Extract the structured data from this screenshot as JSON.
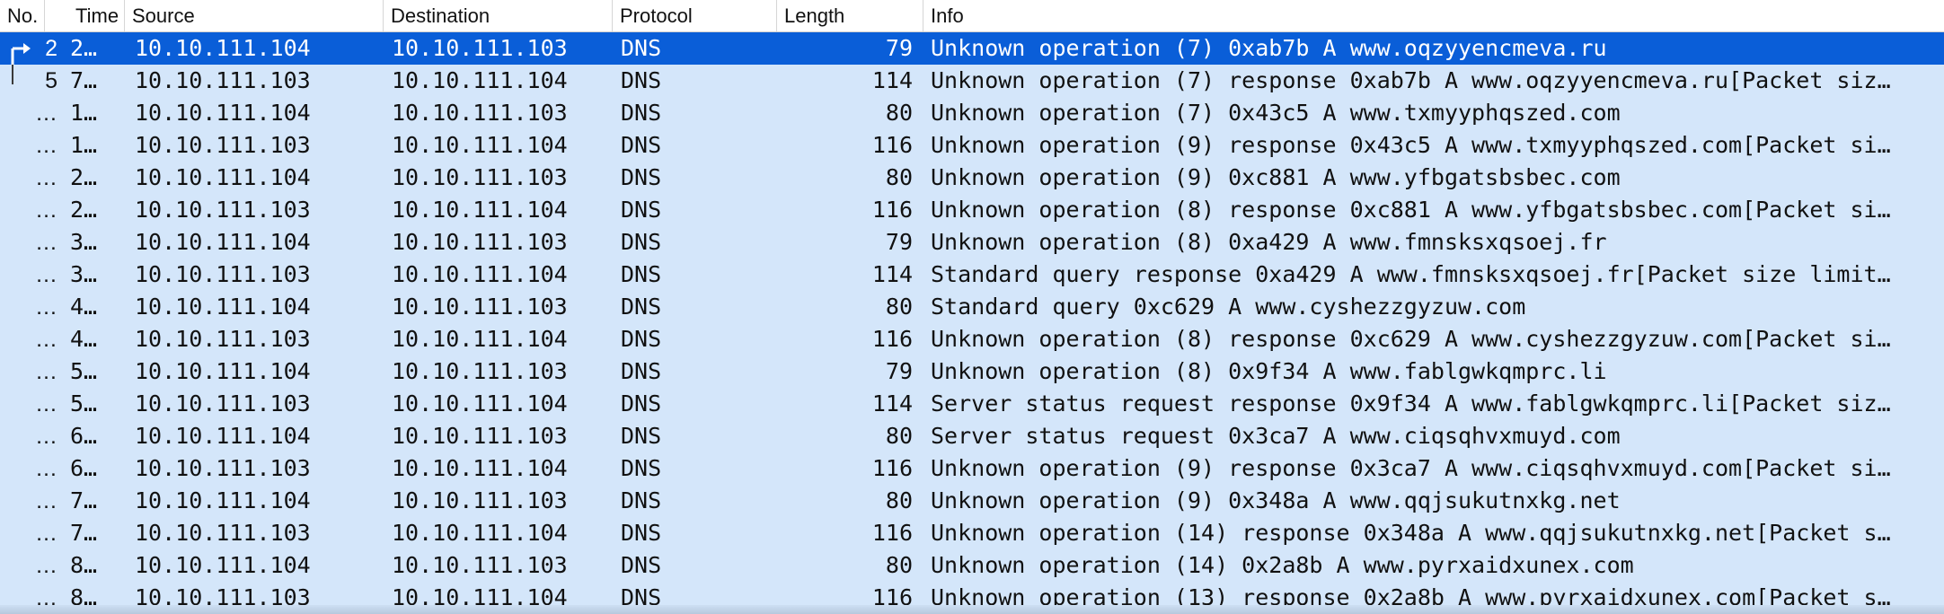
{
  "columns": {
    "no": "No.",
    "time": "Time",
    "source": "Source",
    "destination": "Destination",
    "protocol": "Protocol",
    "length": "Length",
    "info": "Info"
  },
  "colors": {
    "row_bg": "#d4e6fa",
    "selected_bg": "#0a5ed8",
    "selected_text": "#ffffff",
    "text": "#111111"
  },
  "selected_row_index": 0,
  "rows": [
    {
      "no": "2",
      "time": "2…",
      "source": "10.10.111.104",
      "destination": "10.10.111.103",
      "protocol": "DNS",
      "length": "79",
      "info": "Unknown operation (7) 0xab7b A www.oqzyyencmeva.ru"
    },
    {
      "no": "5",
      "time": "7…",
      "source": "10.10.111.103",
      "destination": "10.10.111.104",
      "protocol": "DNS",
      "length": "114",
      "info": "Unknown operation (7) response 0xab7b A www.oqzyyencmeva.ru[Packet siz…"
    },
    {
      "no": "…",
      "time": "1…",
      "source": "10.10.111.104",
      "destination": "10.10.111.103",
      "protocol": "DNS",
      "length": "80",
      "info": "Unknown operation (7) 0x43c5 A www.txmyyphqszed.com"
    },
    {
      "no": "…",
      "time": "1…",
      "source": "10.10.111.103",
      "destination": "10.10.111.104",
      "protocol": "DNS",
      "length": "116",
      "info": "Unknown operation (9) response 0x43c5 A www.txmyyphqszed.com[Packet si…"
    },
    {
      "no": "…",
      "time": "2…",
      "source": "10.10.111.104",
      "destination": "10.10.111.103",
      "protocol": "DNS",
      "length": "80",
      "info": "Unknown operation (9) 0xc881 A www.yfbgatsbsbec.com"
    },
    {
      "no": "…",
      "time": "2…",
      "source": "10.10.111.103",
      "destination": "10.10.111.104",
      "protocol": "DNS",
      "length": "116",
      "info": "Unknown operation (8) response 0xc881 A www.yfbgatsbsbec.com[Packet si…"
    },
    {
      "no": "…",
      "time": "3…",
      "source": "10.10.111.104",
      "destination": "10.10.111.103",
      "protocol": "DNS",
      "length": "79",
      "info": "Unknown operation (8) 0xa429 A www.fmnsksxqsoej.fr"
    },
    {
      "no": "…",
      "time": "3…",
      "source": "10.10.111.103",
      "destination": "10.10.111.104",
      "protocol": "DNS",
      "length": "114",
      "info": "Standard query response 0xa429 A www.fmnsksxqsoej.fr[Packet size limit…"
    },
    {
      "no": "…",
      "time": "4…",
      "source": "10.10.111.104",
      "destination": "10.10.111.103",
      "protocol": "DNS",
      "length": "80",
      "info": "Standard query 0xc629 A www.cyshezzgyzuw.com"
    },
    {
      "no": "…",
      "time": "4…",
      "source": "10.10.111.103",
      "destination": "10.10.111.104",
      "protocol": "DNS",
      "length": "116",
      "info": "Unknown operation (8) response 0xc629 A www.cyshezzgyzuw.com[Packet si…"
    },
    {
      "no": "…",
      "time": "5…",
      "source": "10.10.111.104",
      "destination": "10.10.111.103",
      "protocol": "DNS",
      "length": "79",
      "info": "Unknown operation (8) 0x9f34 A www.fablgwkqmprc.li"
    },
    {
      "no": "…",
      "time": "5…",
      "source": "10.10.111.103",
      "destination": "10.10.111.104",
      "protocol": "DNS",
      "length": "114",
      "info": "Server status request response 0x9f34 A www.fablgwkqmprc.li[Packet siz…"
    },
    {
      "no": "…",
      "time": "6…",
      "source": "10.10.111.104",
      "destination": "10.10.111.103",
      "protocol": "DNS",
      "length": "80",
      "info": "Server status request 0x3ca7 A www.ciqsqhvxmuyd.com"
    },
    {
      "no": "…",
      "time": "6…",
      "source": "10.10.111.103",
      "destination": "10.10.111.104",
      "protocol": "DNS",
      "length": "116",
      "info": "Unknown operation (9) response 0x3ca7 A www.ciqsqhvxmuyd.com[Packet si…"
    },
    {
      "no": "…",
      "time": "7…",
      "source": "10.10.111.104",
      "destination": "10.10.111.103",
      "protocol": "DNS",
      "length": "80",
      "info": "Unknown operation (9) 0x348a A www.qqjsukutnxkg.net"
    },
    {
      "no": "…",
      "time": "7…",
      "source": "10.10.111.103",
      "destination": "10.10.111.104",
      "protocol": "DNS",
      "length": "116",
      "info": "Unknown operation (14) response 0x348a A www.qqjsukutnxkg.net[Packet s…"
    },
    {
      "no": "…",
      "time": "8…",
      "source": "10.10.111.104",
      "destination": "10.10.111.103",
      "protocol": "DNS",
      "length": "80",
      "info": "Unknown operation (14) 0x2a8b A www.pyrxaidxunex.com"
    },
    {
      "no": "…",
      "time": "8…",
      "source": "10.10.111.103",
      "destination": "10.10.111.104",
      "protocol": "DNS",
      "length": "116",
      "info": "Unknown operation (13) response 0x2a8b A www.pyrxaidxunex.com[Packet s…"
    }
  ]
}
